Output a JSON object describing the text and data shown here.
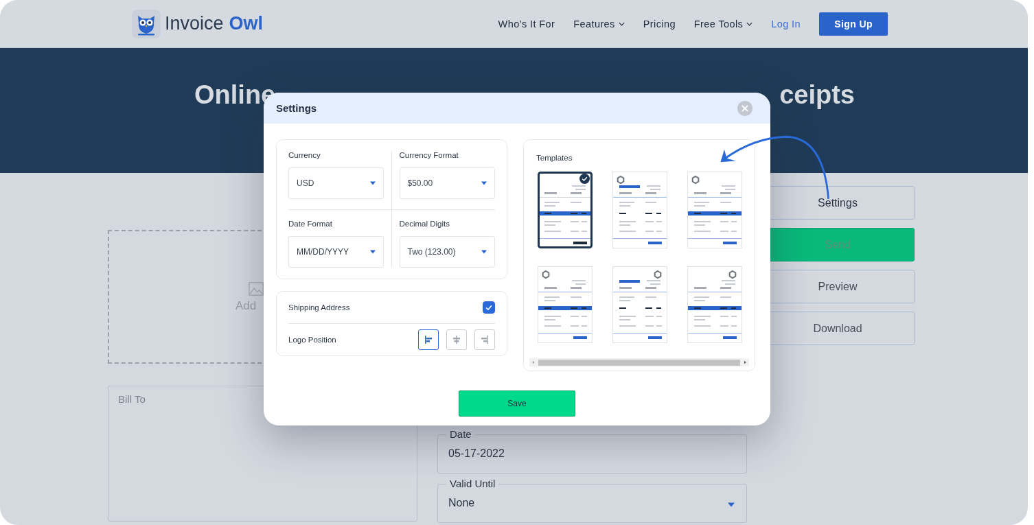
{
  "header": {
    "logo": {
      "word_1": "Invoice",
      "word_2": "Owl"
    },
    "nav": [
      {
        "label": "Who’s It For",
        "dropdown": false
      },
      {
        "label": "Features",
        "dropdown": true
      },
      {
        "label": "Pricing",
        "dropdown": false
      },
      {
        "label": "Free Tools",
        "dropdown": true
      }
    ],
    "login": "Log In",
    "signup": "Sign Up"
  },
  "hero": {
    "title_left": "Online",
    "title_right": "ceipts"
  },
  "form": {
    "logo_upload": "Add",
    "bill_to": "Bill To",
    "date": {
      "label": "Date",
      "value": "05-17-2022"
    },
    "valid_until": {
      "label": "Valid Until",
      "value": "None"
    },
    "actions": [
      {
        "label": "Settings",
        "kind": "outline"
      },
      {
        "label": "Send",
        "kind": "primary"
      },
      {
        "label": "Preview",
        "kind": "outline"
      },
      {
        "label": "Download",
        "kind": "outline"
      }
    ]
  },
  "settings": {
    "title": "Settings",
    "selects": [
      {
        "label": "Currency",
        "value": "USD"
      },
      {
        "label": "Currency Format",
        "value": "$50.00"
      },
      {
        "label": "Date Format",
        "value": "MM/DD/YYYY"
      },
      {
        "label": "Decimal Digits",
        "value": "Two (123.00)"
      }
    ],
    "shipping_address": {
      "label": "Shipping Address",
      "checked": true
    },
    "logo_position": {
      "label": "Logo Position",
      "options": [
        {
          "kind": "left",
          "selected": true
        },
        {
          "kind": "center",
          "selected": false
        },
        {
          "kind": "right",
          "selected": false
        }
      ]
    },
    "templates": {
      "label": "Templates",
      "items": [
        {
          "selected": true
        },
        {
          "selected": false
        },
        {
          "selected": false
        },
        {
          "selected": false
        },
        {
          "selected": false
        },
        {
          "selected": false
        }
      ]
    },
    "save": "Save"
  }
}
